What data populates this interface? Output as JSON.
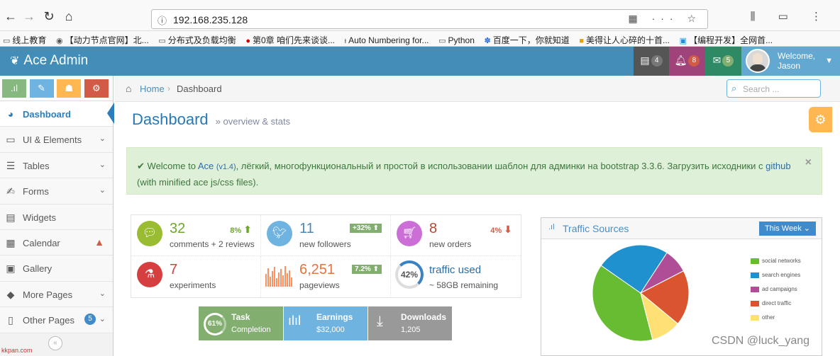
{
  "browser": {
    "url": "192.168.235.128",
    "bookmarks": [
      {
        "label": "线上教育"
      },
      {
        "label": "【动力节点官网】北..."
      },
      {
        "label": "分布式及负载均衡"
      },
      {
        "label": "第0章 咱们先来谈谈..."
      },
      {
        "label": "Auto Numbering for..."
      },
      {
        "label": "Python"
      },
      {
        "label": "百度一下，你就知道"
      },
      {
        "label": "美得让人心碎的十首..."
      },
      {
        "label": "【编程开发】全网首..."
      }
    ]
  },
  "navbar": {
    "brand": "Ace Admin",
    "tasks_count": "4",
    "notifications_count": "8",
    "messages_count": "5",
    "welcome": "Welcome,",
    "user": "Jason",
    "colors": {
      "tasks": "#555555",
      "notifications": "#a0437b",
      "messages": "#2e8965"
    }
  },
  "sidebar": {
    "items": [
      {
        "label": "Dashboard",
        "icon": "tachometer-icon"
      },
      {
        "label": "UI & Elements",
        "icon": "desktop-icon"
      },
      {
        "label": "Tables",
        "icon": "list-icon"
      },
      {
        "label": "Forms",
        "icon": "pencil-square-icon"
      },
      {
        "label": "Widgets",
        "icon": "list-alt-icon"
      },
      {
        "label": "Calendar",
        "icon": "calendar-icon"
      },
      {
        "label": "Gallery",
        "icon": "picture-icon"
      },
      {
        "label": "More Pages",
        "icon": "tag-icon"
      },
      {
        "label": "Other Pages",
        "icon": "file-icon",
        "badge": "5"
      }
    ]
  },
  "breadcrumb": {
    "home": "Home",
    "current": "Dashboard"
  },
  "search": {
    "placeholder": "Search ..."
  },
  "page": {
    "title": "Dashboard",
    "subtitle": "» overview & stats"
  },
  "alert": {
    "prefix": "Welcome to",
    "product": "Ace",
    "version": "(v1.4)",
    "text": ", лёгкий, многофункциональный и простой в использовании шаблон для админки на bootstrap 3.3.6. Загрузить исходники с",
    "link": "github",
    "suffix": "(with minified ace js/css files)."
  },
  "infoboxes": [
    {
      "number": "32",
      "label": "comments + 2 reviews",
      "stat": "8%",
      "color": "#6fb3e0"
    },
    {
      "number": "11",
      "label": "new followers",
      "stat": "+32%",
      "color": "#6fb3e0"
    },
    {
      "number": "8",
      "label": "new orders",
      "stat": "4%",
      "color": "#cb6fd7"
    },
    {
      "number": "7",
      "label": "experiments",
      "color": "#d53f40"
    },
    {
      "number": "6,251",
      "label": "pageviews",
      "stat": "7.2%",
      "color": "#f79263"
    },
    {
      "number": "traffic used",
      "label": "~ 58GB remaining",
      "percent": "42%"
    }
  ],
  "buttons": [
    {
      "title": "Task",
      "sub": "Completion",
      "percent": "61%"
    },
    {
      "title": "Earnings",
      "sub": "$32,000"
    },
    {
      "title": "Downloads",
      "sub": "1,205"
    }
  ],
  "widget": {
    "title": "Traffic Sources",
    "range": "This Week"
  },
  "chart_data": {
    "type": "pie",
    "categories": [
      "social networks",
      "search engines",
      "ad campaigns",
      "direct traffic",
      "other"
    ],
    "values": [
      38.7,
      24.5,
      8.2,
      18.6,
      10
    ],
    "colors": [
      "#68bc31",
      "#2091cf",
      "#af4e96",
      "#da5430",
      "#fee074"
    ]
  },
  "watermark": "CSDN @luck_yang",
  "site_mark": "kkpan.com"
}
